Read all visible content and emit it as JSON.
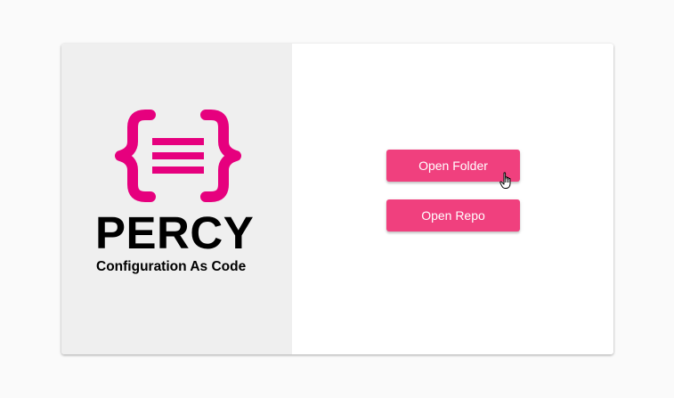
{
  "brand": {
    "name": "PERCY",
    "tagline": "Configuration As Code",
    "logo_icon": "curly-braces-menu-icon",
    "accent_color": "#e6007e"
  },
  "actions": {
    "open_folder_label": "Open Folder",
    "open_repo_label": "Open Repo",
    "button_color": "#f0407e"
  },
  "cursor": {
    "icon": "hand-pointer-icon"
  }
}
